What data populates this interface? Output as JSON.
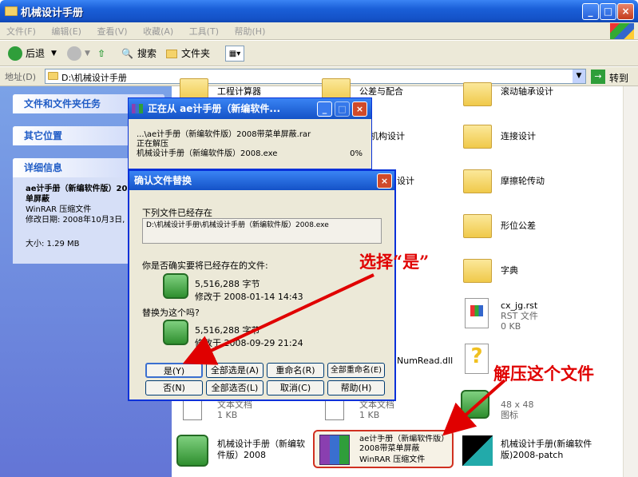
{
  "window": {
    "title": "机械设计手册"
  },
  "menu": [
    "文件(F)",
    "编辑(E)",
    "查看(V)",
    "收藏(A)",
    "工具(T)",
    "帮助(H)"
  ],
  "toolbar": {
    "back": "后退",
    "search": "搜索",
    "folders": "文件夹"
  },
  "address": {
    "label": "地址(D)",
    "value": "D:\\机械设计手册",
    "go": "转到"
  },
  "left": {
    "tasks_title": "文件和文件夹任务",
    "other_title": "其它位置",
    "details_title": "详细信息",
    "detail_name": "ae计手册（新编软件版）2008带菜单屏蔽",
    "detail_type": "WinRAR 压缩文件",
    "detail_modified": "修改日期: 2008年10月3日, 09:48",
    "detail_size": "大小: 1.29 MB"
  },
  "items": {
    "f1": "工程计算器",
    "f2": "公差与配合",
    "f3": "滚动轴承设计",
    "f4": "机构设计",
    "f5": "连接设计",
    "f6": "设计",
    "f7": "摩擦轮传动",
    "f8": "形位公差",
    "f9": "字典",
    "rst_name": "cx_jg.rst",
    "rst_type": "RST 文件",
    "rst_size": "0 KB",
    "dll": "NumRead.dll",
    "txt1_type": "文本文档",
    "txt1_size": "1 KB",
    "txt2_type": "文本文档",
    "txt2_size": "1 KB",
    "ico_size": "48 x 48",
    "ico_type": "图标",
    "exe1": "机械设计手册（新编软件版）2008",
    "rar": "ae计手册（新编软件版）2008带菜单屏蔽",
    "rar_type": "WinRAR 压缩文件",
    "patch": "机械设计手册(新编软件版)2008-patch"
  },
  "extract": {
    "title": "正在从 ae计手册（新编软件...",
    "line1": "...\\ae计手册（新编软件版）2008带菜单屏蔽.rar",
    "line2": "正在解压",
    "line3": "机械设计手册（新编软件版）2008.exe",
    "percent": "0%"
  },
  "confirm": {
    "title": "确认文件替换",
    "exists": "下列文件已经存在",
    "path": "D:\\机械设计手册\\机械设计手册（新编软件版）2008.exe",
    "question": "你是否确实要将已经存在的文件:",
    "size1": "5,516,288 字节",
    "date1": "修改于 2008-01-14 14:43",
    "replace_with": "替换为这个吗?",
    "size2": "5,516,288 字节",
    "date2": "修改于 2008-09-29 21:24",
    "btn_yes": "是(Y)",
    "btn_yes_all": "全部选是(A)",
    "btn_rename": "重命名(R)",
    "btn_rename_all": "全部重命名(E)",
    "btn_no": "否(N)",
    "btn_no_all": "全部选否(L)",
    "btn_cancel": "取消(C)",
    "btn_help": "帮助(H)"
  },
  "annotations": {
    "choose_yes": "选择“是”",
    "extract_this": "解压这个文件"
  }
}
